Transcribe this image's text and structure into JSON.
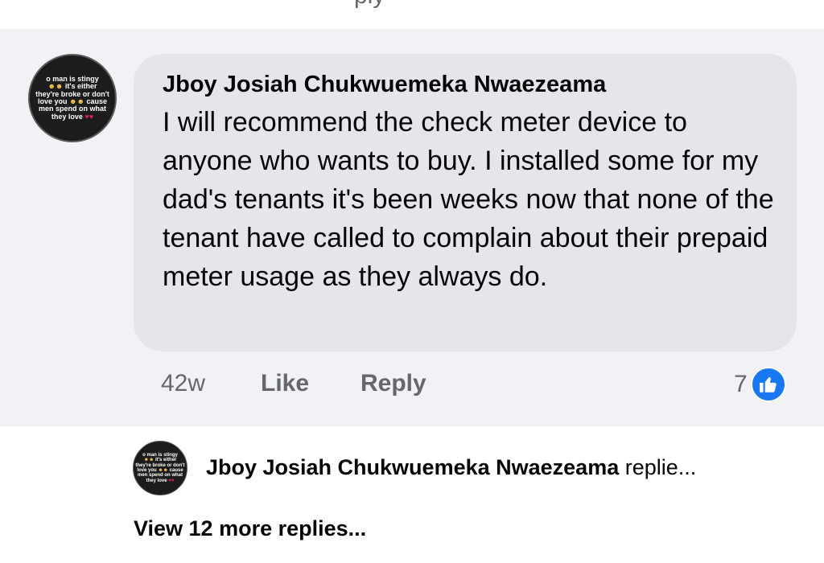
{
  "top": {
    "cut_text": "ply"
  },
  "comment": {
    "avatar_text": [
      "o man is stingy",
      "it's either",
      "they're broke or don't",
      "love you",
      "cause",
      "men spend on what",
      "they love"
    ],
    "author": "Jboy Josiah Chukwuemeka Nwaezeama",
    "text": "I will recommend the check meter device to anyone who wants to buy. I installed some for my dad's tenants it's been weeks now that none of the tenant have called to complain about their prepaid meter usage as they always do.",
    "time": "42w",
    "like_label": "Like",
    "reply_label": "Reply",
    "reaction_count": "7",
    "reaction_icon": "thumbs-up-icon",
    "reaction_color": "#1877f2"
  },
  "reply_preview": {
    "avatar_text": [
      "o man is stingy",
      "it's either",
      "they're broke or don't",
      "love you",
      "cause",
      "men spend on what",
      "they love"
    ],
    "author": "Jboy Josiah Chukwuemeka Nwaezeama",
    "action": "replie..."
  },
  "view_more": "View 12 more replies..."
}
